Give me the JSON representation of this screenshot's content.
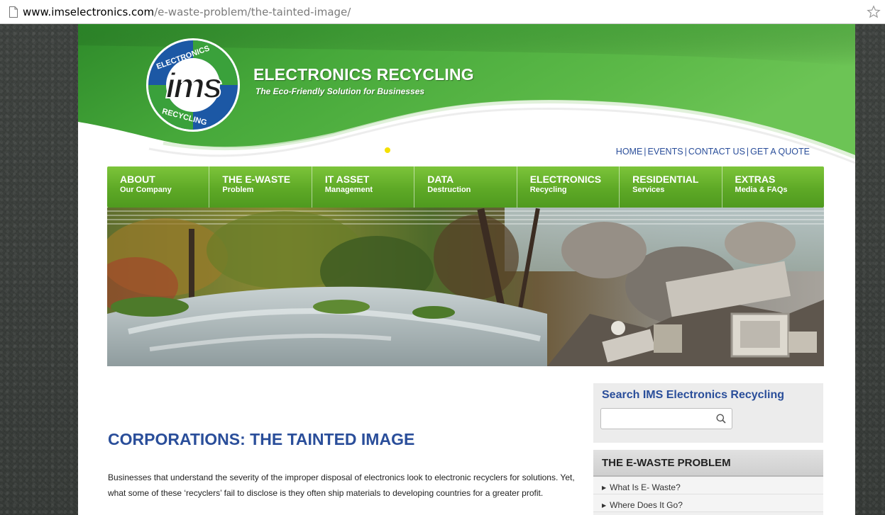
{
  "browser": {
    "url_domain": "www.imselectronics.com",
    "url_path": "/e-waste-problem/the-tainted-image/"
  },
  "header": {
    "logo_letters": "ims",
    "logo_ring_top": "ELECTRONICS",
    "logo_ring_bottom": "RECYCLING",
    "title": "ELECTRONICS RECYCLING",
    "tagline": "The Eco-Friendly Solution for Businesses"
  },
  "top_links": [
    "HOME",
    "EVENTS",
    "CONTACT US",
    "GET A QUOTE"
  ],
  "nav": [
    {
      "main": "ABOUT",
      "sub": "Our Company"
    },
    {
      "main": "THE E-WASTE",
      "sub": "Problem"
    },
    {
      "main": "IT ASSET",
      "sub": "Management"
    },
    {
      "main": "DATA",
      "sub": "Destruction"
    },
    {
      "main": "ELECTRONICS",
      "sub": "Recycling"
    },
    {
      "main": "RESIDENTIAL",
      "sub": "Services"
    },
    {
      "main": "EXTRAS",
      "sub": "Media & FAQs"
    }
  ],
  "article": {
    "title": "CORPORATIONS: THE TAINTED IMAGE",
    "body": "Businesses that understand the severity of the improper disposal of electronics look to electronic recyclers for solutions. Yet, what some of these ‘recyclers’ fail to disclose is they often ship materials to developing countries for a greater profit."
  },
  "sidebar": {
    "search_title": "Search IMS Electronics Recycling",
    "search_value": "",
    "panel_title": "THE E-WASTE PROBLEM",
    "panel_items": [
      "What Is E- Waste?",
      "Where Does It Go?"
    ]
  },
  "colors": {
    "brand_green": "#5ea926",
    "link_blue": "#2a4e9a",
    "accent_yellow": "#f4e000"
  }
}
